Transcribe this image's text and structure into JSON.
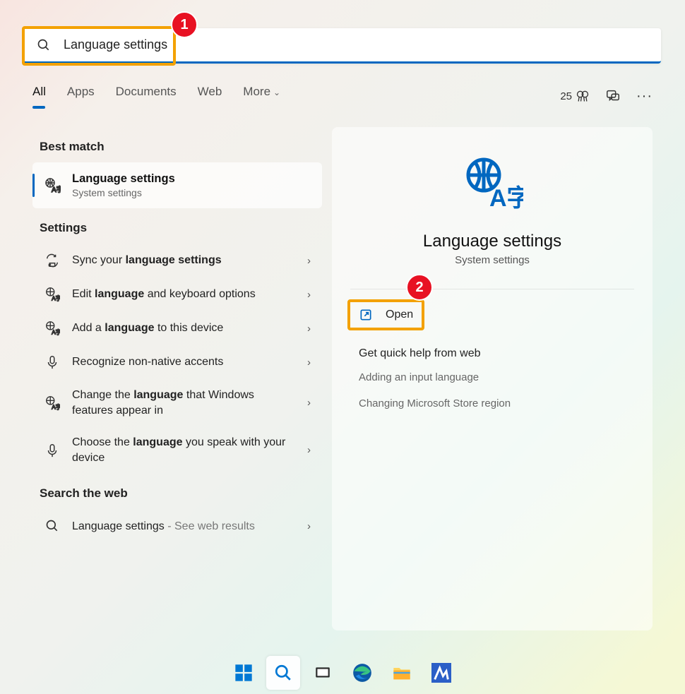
{
  "search": {
    "value": "Language settings"
  },
  "tabs": {
    "all": "All",
    "apps": "Apps",
    "documents": "Documents",
    "web": "Web",
    "more": "More"
  },
  "rewards": {
    "points": "25"
  },
  "sections": {
    "best_match": "Best match",
    "settings": "Settings",
    "search_web": "Search the web"
  },
  "best_match": {
    "title": "Language settings",
    "subtitle": "System settings"
  },
  "settings_items": {
    "sync_pre": "Sync your ",
    "sync_bold": "language settings",
    "edit_pre": "Edit ",
    "edit_bold": "language",
    "edit_post": " and keyboard options",
    "add_pre": "Add a ",
    "add_bold": "language",
    "add_post": " to this device",
    "recognize": "Recognize non-native accents",
    "change_pre": "Change the ",
    "change_bold": "language",
    "change_post": " that Windows features appear in",
    "choose_pre": "Choose the ",
    "choose_bold": "language",
    "choose_post": " you speak with your device"
  },
  "web_item": {
    "title": "Language settings",
    "suffix": " - See web results"
  },
  "preview": {
    "title": "Language settings",
    "subtitle": "System settings",
    "open": "Open",
    "help_heading": "Get quick help from web",
    "help_links": {
      "input": "Adding an input language",
      "region": "Changing Microsoft Store region"
    }
  },
  "callouts": {
    "one": "1",
    "two": "2"
  }
}
